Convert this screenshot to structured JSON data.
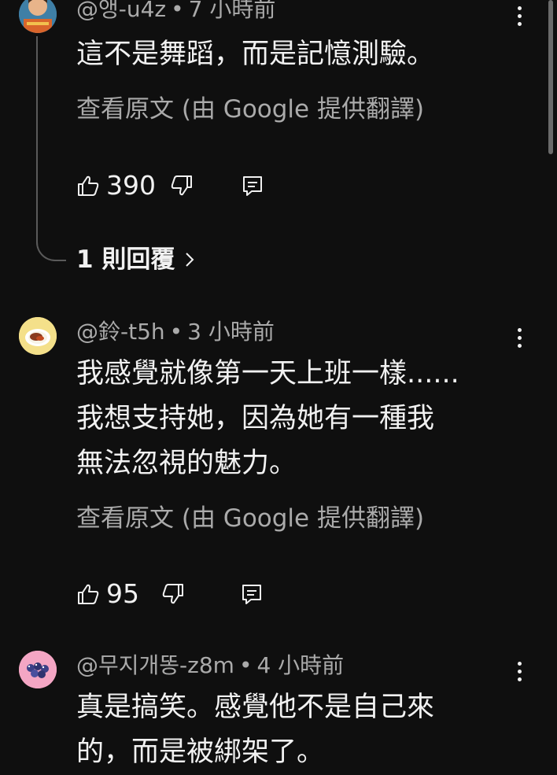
{
  "comments": [
    {
      "author": "@앵-u4z",
      "time": "7 小時前",
      "lines": [
        "這不是舞蹈，而是記憶測驗。"
      ],
      "translate_link": "查看原文 (由 Google 提供翻譯)",
      "likes": "390",
      "replies_label": "1 則回覆",
      "icons": [
        "avatar-cartoon-icon",
        "thumbs-up-icon",
        "thumbs-down-icon",
        "reply-icon",
        "more-vert-icon"
      ]
    },
    {
      "author": "@鈴-t5h",
      "time": "3 小時前",
      "lines": [
        "我感覺就像第一天上班一樣......",
        "我想支持她，因為她有一種我",
        "無法忽視的魅力。"
      ],
      "translate_link": "查看原文 (由 Google 提供翻譯)",
      "likes": "95",
      "icons": [
        "avatar-food-plate-icon",
        "thumbs-up-icon",
        "thumbs-down-icon",
        "reply-icon",
        "more-vert-icon"
      ]
    },
    {
      "author": "@무지개똥-z8m",
      "time": "4 小時前",
      "lines": [
        "真是搞笑。感覺他不是自己來",
        "的，而是被綁架了。"
      ],
      "icons": [
        "avatar-berries-icon",
        "more-vert-icon"
      ]
    }
  ],
  "dot": "•",
  "colors": {
    "background": "#0f0f0f",
    "text_primary": "#f1f1f1",
    "text_secondary": "#aaaaaa",
    "thread_line": "#5a5a5a"
  }
}
